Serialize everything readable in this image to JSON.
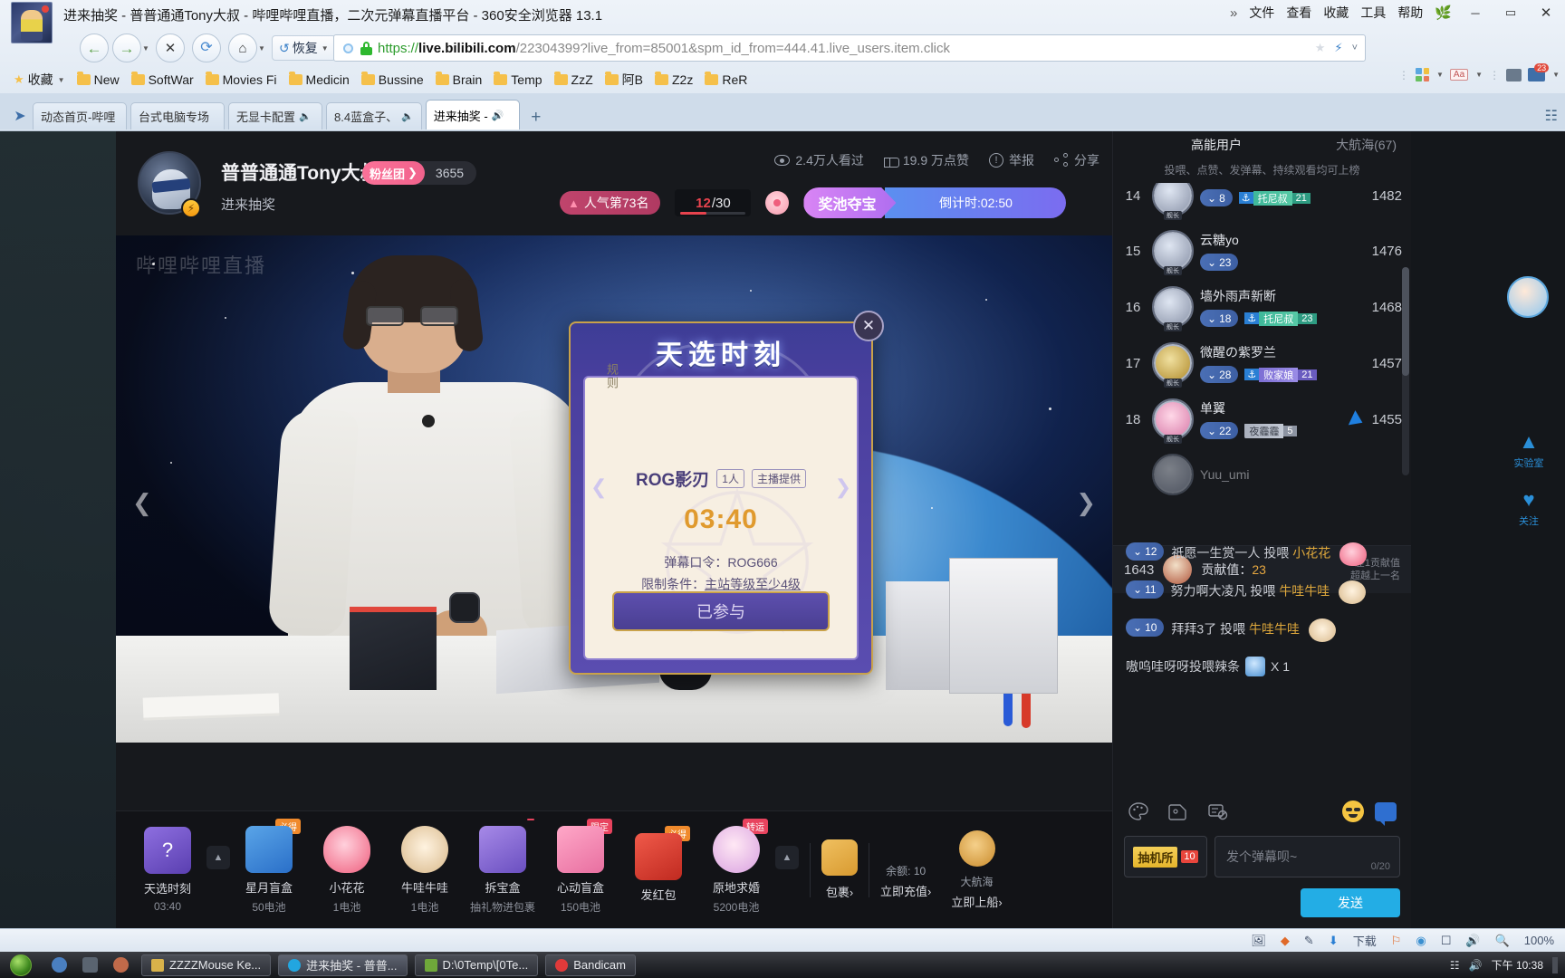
{
  "browser": {
    "window_title": "进来抽奖 - 普普通通Tony大叔 - 哔哩哔哩直播，二次元弹幕直播平台 - 360安全浏览器 13.1",
    "menu": {
      "chevrons": "»",
      "items": [
        "文件",
        "查看",
        "收藏",
        "工具",
        "帮助"
      ],
      "leaf_icon": "leaf-icon"
    },
    "window_controls": {
      "minimize": "─",
      "maximize": "▭",
      "close": "✕"
    },
    "nav": {
      "back": "back-arrow-icon",
      "forward": "forward-arrow-icon",
      "stop": "✕",
      "reload": "⟳",
      "home": "⌂",
      "restore_label": "恢复"
    },
    "address": {
      "scheme": "https://",
      "host": "live.bilibili.com",
      "path": "/22304399?live_from=85001&spm_id_from=444.41.live_users.item.click",
      "lock": "lock-icon",
      "star": "★",
      "lightning": "⚡",
      "caret": "˅"
    },
    "bookmarks": {
      "root_label": "收藏",
      "items": [
        "New",
        "SoftWar",
        "Movies Fi",
        "Medicin",
        "Bussine",
        "Brain",
        "Temp",
        "ZzZ",
        "阿B",
        "Z2z",
        "ReR"
      ],
      "right_tools": {
        "grid": "apps-grid-icon",
        "aa": "Aa",
        "download_count": "23"
      }
    },
    "tabs": [
      {
        "label": "动态首页-哔哩",
        "active": false,
        "muted": false
      },
      {
        "label": "台式电脑专场",
        "active": false,
        "muted": false
      },
      {
        "label": "无显卡配置",
        "active": false,
        "muted": true
      },
      {
        "label": "8.4蓝盒子、",
        "active": false,
        "muted": true
      },
      {
        "label": "进来抽奖 - ",
        "active": true,
        "muted": true
      }
    ],
    "new_tab": "+"
  },
  "live": {
    "streamer": {
      "name": "普普通通Tony大叔",
      "fan_club_label": "粉丝团",
      "fan_count": "3655",
      "room_title": "进来抽奖",
      "level_badge": "⚡"
    },
    "stats": [
      {
        "icon": "eye-icon",
        "text": "2.4万人看过"
      },
      {
        "icon": "thumbs-up-icon",
        "text": "19.9 万点赞"
      },
      {
        "icon": "warning-icon",
        "text": "举报"
      },
      {
        "icon": "share-icon",
        "text": "分享"
      }
    ],
    "badges": {
      "popularity_rank": "人气第73名",
      "progress_current": "12",
      "progress_total": "/30",
      "flower_icon": "flower-icon",
      "pool_label": "奖池夺宝",
      "countdown": "倒计时:02:50"
    },
    "watermark": "哔哩哔哩直播"
  },
  "lottery": {
    "title": "天选时刻",
    "rules_label": "规则",
    "close": "✕",
    "prize_name": "ROG影刃",
    "prize_count": "1人",
    "prize_source": "主播提供",
    "timer": "03:40",
    "condition_keyword_label": "弹幕口令：",
    "condition_keyword": "ROG666",
    "condition_limit_label": "限制条件：",
    "condition_limit": "主站等级至少4级",
    "join_button": "已参与"
  },
  "gifts": {
    "items": [
      {
        "name": "天选时刻",
        "price": "03:40",
        "corner": "",
        "corner_color": "",
        "icon_color": "#7b5fd6"
      },
      {
        "name": "星月盲盒",
        "price": "50电池",
        "corner": "必得",
        "corner_color": "#f08a2c",
        "icon_color": "#3a7fd5"
      },
      {
        "name": "小花花",
        "price": "1电池",
        "corner": "",
        "corner_color": "",
        "icon_color": "#ef5e7d"
      },
      {
        "name": "牛哇牛哇",
        "price": "1电池",
        "corner": "",
        "corner_color": "",
        "icon_color": "#e8c9a0"
      },
      {
        "name": "拆宝盒",
        "price": "抽礼物进包裹",
        "corner": "",
        "corner_color": "",
        "icon_color": "#8a6fd8"
      },
      {
        "name": "心动盲盒",
        "price": "150电池",
        "corner": "限定",
        "corner_color": "#e8435e",
        "icon_color": "#f08ab0"
      },
      {
        "name": "发红包",
        "price": "",
        "corner": "必得",
        "corner_color": "#f08a2c",
        "icon_color": "#e03a3a"
      },
      {
        "name": "原地求婚",
        "price": "5200电池",
        "corner": "转运",
        "corner_color": "#e8435e",
        "icon_color": "#d8a0e0"
      }
    ],
    "expand_icon": "chevron-up-icon",
    "package": {
      "label": "包裹",
      "chevron": "›",
      "icon": "package-icon"
    },
    "balance": {
      "label": "余额: 10",
      "action": "立即充值",
      "chevron": "›"
    },
    "voyage": {
      "label": "大航海",
      "action": "立即上船",
      "chevron": "›",
      "icon": "anchor-icon"
    }
  },
  "rank_panel": {
    "tab_active": "高能用户",
    "tab_other": "大航海(67)",
    "subtitle": "投喂、点赞、发弹幕、持续观看均可上榜",
    "rows": [
      {
        "idx": "14",
        "name": "",
        "level": "8",
        "medal": "托尼叔",
        "medal_level": "21",
        "medal_style": "teal",
        "score": "1482",
        "avatar_caption": "舰长"
      },
      {
        "idx": "15",
        "name": "云糖yo",
        "level": "23",
        "medal": "",
        "medal_level": "",
        "medal_style": "",
        "score": "1476",
        "avatar_caption": "舰长"
      },
      {
        "idx": "16",
        "name": "墙外雨声新断",
        "level": "18",
        "medal": "托尼叔",
        "medal_level": "23",
        "medal_style": "teal",
        "score": "1468",
        "avatar_caption": "舰长"
      },
      {
        "idx": "17",
        "name": "微醒の紫罗兰",
        "level": "28",
        "medal": "败家娘",
        "medal_level": "21",
        "medal_style": "purple",
        "score": "1457",
        "avatar_caption": "舰长"
      },
      {
        "idx": "18",
        "name": "单翼",
        "level": "22",
        "medal": "夜霾霾",
        "medal_level": "5",
        "medal_style": "gray",
        "score": "1455",
        "avatar_caption": "舰长"
      },
      {
        "idx": "",
        "name": "Yuu_umi",
        "level": "",
        "medal": "",
        "medal_level": "",
        "medal_style": "",
        "score": "",
        "avatar_caption": ""
      }
    ],
    "self": {
      "rank": "1643",
      "contribution_label": "贡献值：",
      "contribution_value": "23",
      "diff_line1": "差1贡献值",
      "diff_line2": "超越上一名"
    }
  },
  "chat": {
    "messages": [
      {
        "level": "12",
        "user": "祇愿一生赏一人",
        "action": "投喂",
        "gift": "小花花",
        "gift_icon": "flower-gift-icon"
      },
      {
        "level": "11",
        "user": "努力啊大凌凡",
        "action": "投喂",
        "gift": "牛哇牛哇",
        "gift_icon": "cow-gift-icon"
      },
      {
        "level": "10",
        "user": "拜拜3了",
        "action": "投喂",
        "gift": "牛哇牛哇",
        "gift_icon": "cow-gift-icon"
      }
    ],
    "plain_message": {
      "text": "嗷呜哇呀呀投喂辣条",
      "icon": "spicy-strip-icon",
      "count": "X 1"
    },
    "tools": [
      {
        "icon": "palette-icon"
      },
      {
        "icon": "sticker-icon"
      },
      {
        "icon": "block-danmaku-icon"
      }
    ],
    "right_tools": [
      {
        "icon": "emoji-icon"
      },
      {
        "icon": "danmaku-toggle-icon"
      }
    ],
    "lottery_button": {
      "label": "抽机所",
      "count": "10"
    },
    "input_placeholder": "发个弹幕呗~",
    "input_value": "",
    "char_counter": "0/20",
    "send_button": "发送"
  },
  "float_buttons": [
    {
      "icon": "upload-icon",
      "label": "实验室"
    },
    {
      "icon": "heart-icon",
      "label": "关注"
    }
  ],
  "status_bar": {
    "items": [
      "下载",
      "100%"
    ],
    "icons": [
      "image-icon",
      "shield-icon",
      "edit-icon",
      "download-icon",
      "flag-icon",
      "globe-icon",
      "window-icon",
      "sound-icon",
      "zoom-icon"
    ]
  },
  "taskbar": {
    "start": "start-orb-icon",
    "quick_launch": [
      "browser-icon",
      "media-icon",
      "app-icon"
    ],
    "buttons": [
      {
        "label": "ZZZZMouse Ke...",
        "icon_color": "#d8b24a"
      },
      {
        "label": "进来抽奖 - 普普...",
        "icon_color": "#22a6e0",
        "active": true
      },
      {
        "label": "D:\\0Temp\\[0Te...",
        "icon_color": "#6fa83a"
      },
      {
        "label": "Bandicam",
        "icon_color": "#e03a3a"
      }
    ],
    "tray_time": "下午 10:38",
    "tray_icons": [
      "network-icon",
      "volume-icon",
      "action-center-icon"
    ]
  }
}
